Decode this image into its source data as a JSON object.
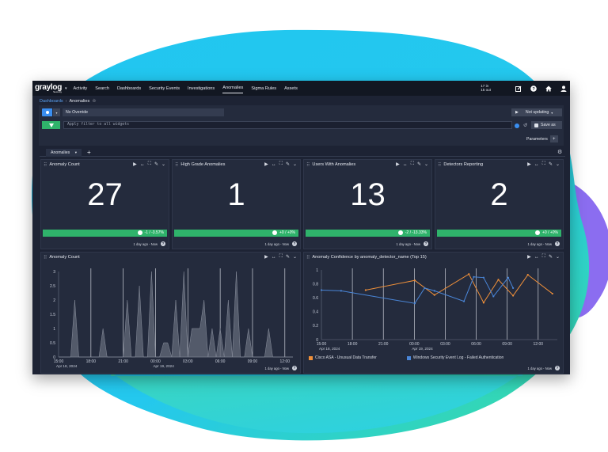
{
  "colors": {
    "background_blob_cyan": "#21c6f0",
    "background_blob_green": "#39dca0",
    "background_blob_purple": "#8b6df0",
    "app_bg": "#1d2334",
    "navbar_bg": "#121722",
    "panel_bg": "#242b3d",
    "accent_blue": "#3a8ef0",
    "success_green": "#2fb36b",
    "series_orange": "#f0903a",
    "series_blue": "#4a86d8"
  },
  "navbar": {
    "logo": "graylog",
    "logo_sub": "Security",
    "items": [
      "Activity",
      "Search",
      "Dashboards",
      "Security Events",
      "Investigations",
      "Anomalies",
      "Sigma Rules",
      "Assets"
    ],
    "active_item": "Anomalies",
    "throughput_in": "17 in",
    "throughput_out": "15 out",
    "icons": [
      "edit-icon",
      "help-icon",
      "home-icon",
      "user-icon"
    ]
  },
  "breadcrumb": {
    "parent": "Dashboards",
    "separator": "›",
    "current": "Anomalies"
  },
  "controls": {
    "override": "No Override",
    "not_updating": "Not updating",
    "query_placeholder": "Apply filter to all widgets",
    "save_as": "Save as",
    "parameters": "Parameters",
    "parameters_add": "+"
  },
  "tabs": {
    "active": "Anomalies",
    "caret": "▾",
    "add": "+"
  },
  "widgets": {
    "actions": [
      "▶",
      "↔",
      "⛶",
      "✎",
      "⌄"
    ],
    "footer": "1 day ago - Now",
    "footer_icon": "?",
    "anomaly_count": {
      "title": "Anomaly Count",
      "value": "27",
      "trend": "-1 / -3.57%"
    },
    "high_grade": {
      "title": "High Grade Anomalies",
      "value": "1",
      "trend": "+0 / +0%"
    },
    "users_with": {
      "title": "Users With Anomalies",
      "value": "13",
      "trend": "-2 / -13.33%"
    },
    "detectors": {
      "title": "Detectors Reporting",
      "value": "2",
      "trend": "+0 / +0%"
    },
    "count_chart_title": "Anomaly Count",
    "confidence_chart_title": "Anomaly Confidence by anomaly_detector_name (Top 15)"
  },
  "chart_data": [
    {
      "type": "area",
      "title": "Anomaly Count",
      "xlabel": "",
      "ylabel": "",
      "ylim": [
        0,
        3
      ],
      "yticks": [
        "0",
        "0.5",
        "1",
        "1.5",
        "2",
        "2.5",
        "3"
      ],
      "xticks": [
        "15:00",
        "18:00",
        "21:00",
        "00:00",
        "03:00",
        "06:00",
        "09:00",
        "12:00"
      ],
      "xtick_sublabels": {
        "15:00": "Apr 18, 2024",
        "00:00": "Apr 19, 2024"
      },
      "grid": true,
      "x": [
        0.0,
        1.5,
        2.0,
        2.5,
        3.5,
        5.0,
        5.5,
        6.0,
        8.0,
        8.5,
        9.0,
        9.5,
        10.0,
        10.5,
        11.0,
        11.5,
        12.0,
        12.5,
        13.0,
        13.5,
        14.0,
        14.5,
        15.0,
        15.5,
        16.0,
        16.5,
        17.0,
        17.5,
        18.0,
        18.5,
        19.0,
        19.5,
        20.0,
        20.5,
        21.0,
        21.5,
        22.0,
        22.5,
        23.0,
        23.5,
        24.0,
        25.5,
        26.0,
        26.5,
        27.0,
        27.5,
        28.0,
        28.5,
        29.0
      ],
      "values": [
        0,
        0,
        2,
        0,
        0,
        0,
        1,
        0,
        0,
        2,
        0,
        0,
        2.5,
        0,
        0,
        3,
        0,
        0,
        0.5,
        0.5,
        0,
        2,
        0,
        3,
        0,
        1,
        1,
        1,
        2,
        0,
        1,
        0,
        1,
        0,
        2,
        0,
        3,
        0,
        0,
        1,
        0,
        0,
        1,
        0,
        0,
        0,
        0,
        0,
        0
      ]
    },
    {
      "type": "line",
      "title": "Anomaly Confidence by anomaly_detector_name (Top 15)",
      "xlabel": "",
      "ylabel": "",
      "ylim": [
        0,
        1
      ],
      "yticks": [
        "0",
        "0.2",
        "0.4",
        "0.6",
        "0.8",
        "1"
      ],
      "xticks": [
        "15:00",
        "18:00",
        "21:00",
        "00:00",
        "03:00",
        "06:00",
        "09:00",
        "12:00"
      ],
      "xtick_sublabels": {
        "15:00": "Apr 18, 2024",
        "00:00": "Apr 19, 2024"
      },
      "grid": true,
      "legend": "bottom",
      "series": [
        {
          "name": "Cisco ASA - Unusual Data Transfer",
          "x": [
            4.5,
            9.5,
            11.5,
            15.0,
            16.5,
            18.0,
            19.5,
            21.0,
            23.5
          ],
          "values": [
            0.71,
            0.85,
            0.64,
            0.94,
            0.53,
            0.86,
            0.63,
            0.93,
            0.66
          ]
        },
        {
          "name": "Windows Security Event Log - Failed Authentication",
          "x": [
            0.0,
            2.0,
            9.5,
            10.5,
            11.5,
            14.5,
            15.5,
            16.5,
            17.5,
            19.0,
            19.5
          ],
          "values": [
            0.71,
            0.7,
            0.52,
            0.74,
            0.7,
            0.55,
            0.9,
            0.89,
            0.62,
            0.89,
            0.74
          ]
        }
      ]
    }
  ]
}
